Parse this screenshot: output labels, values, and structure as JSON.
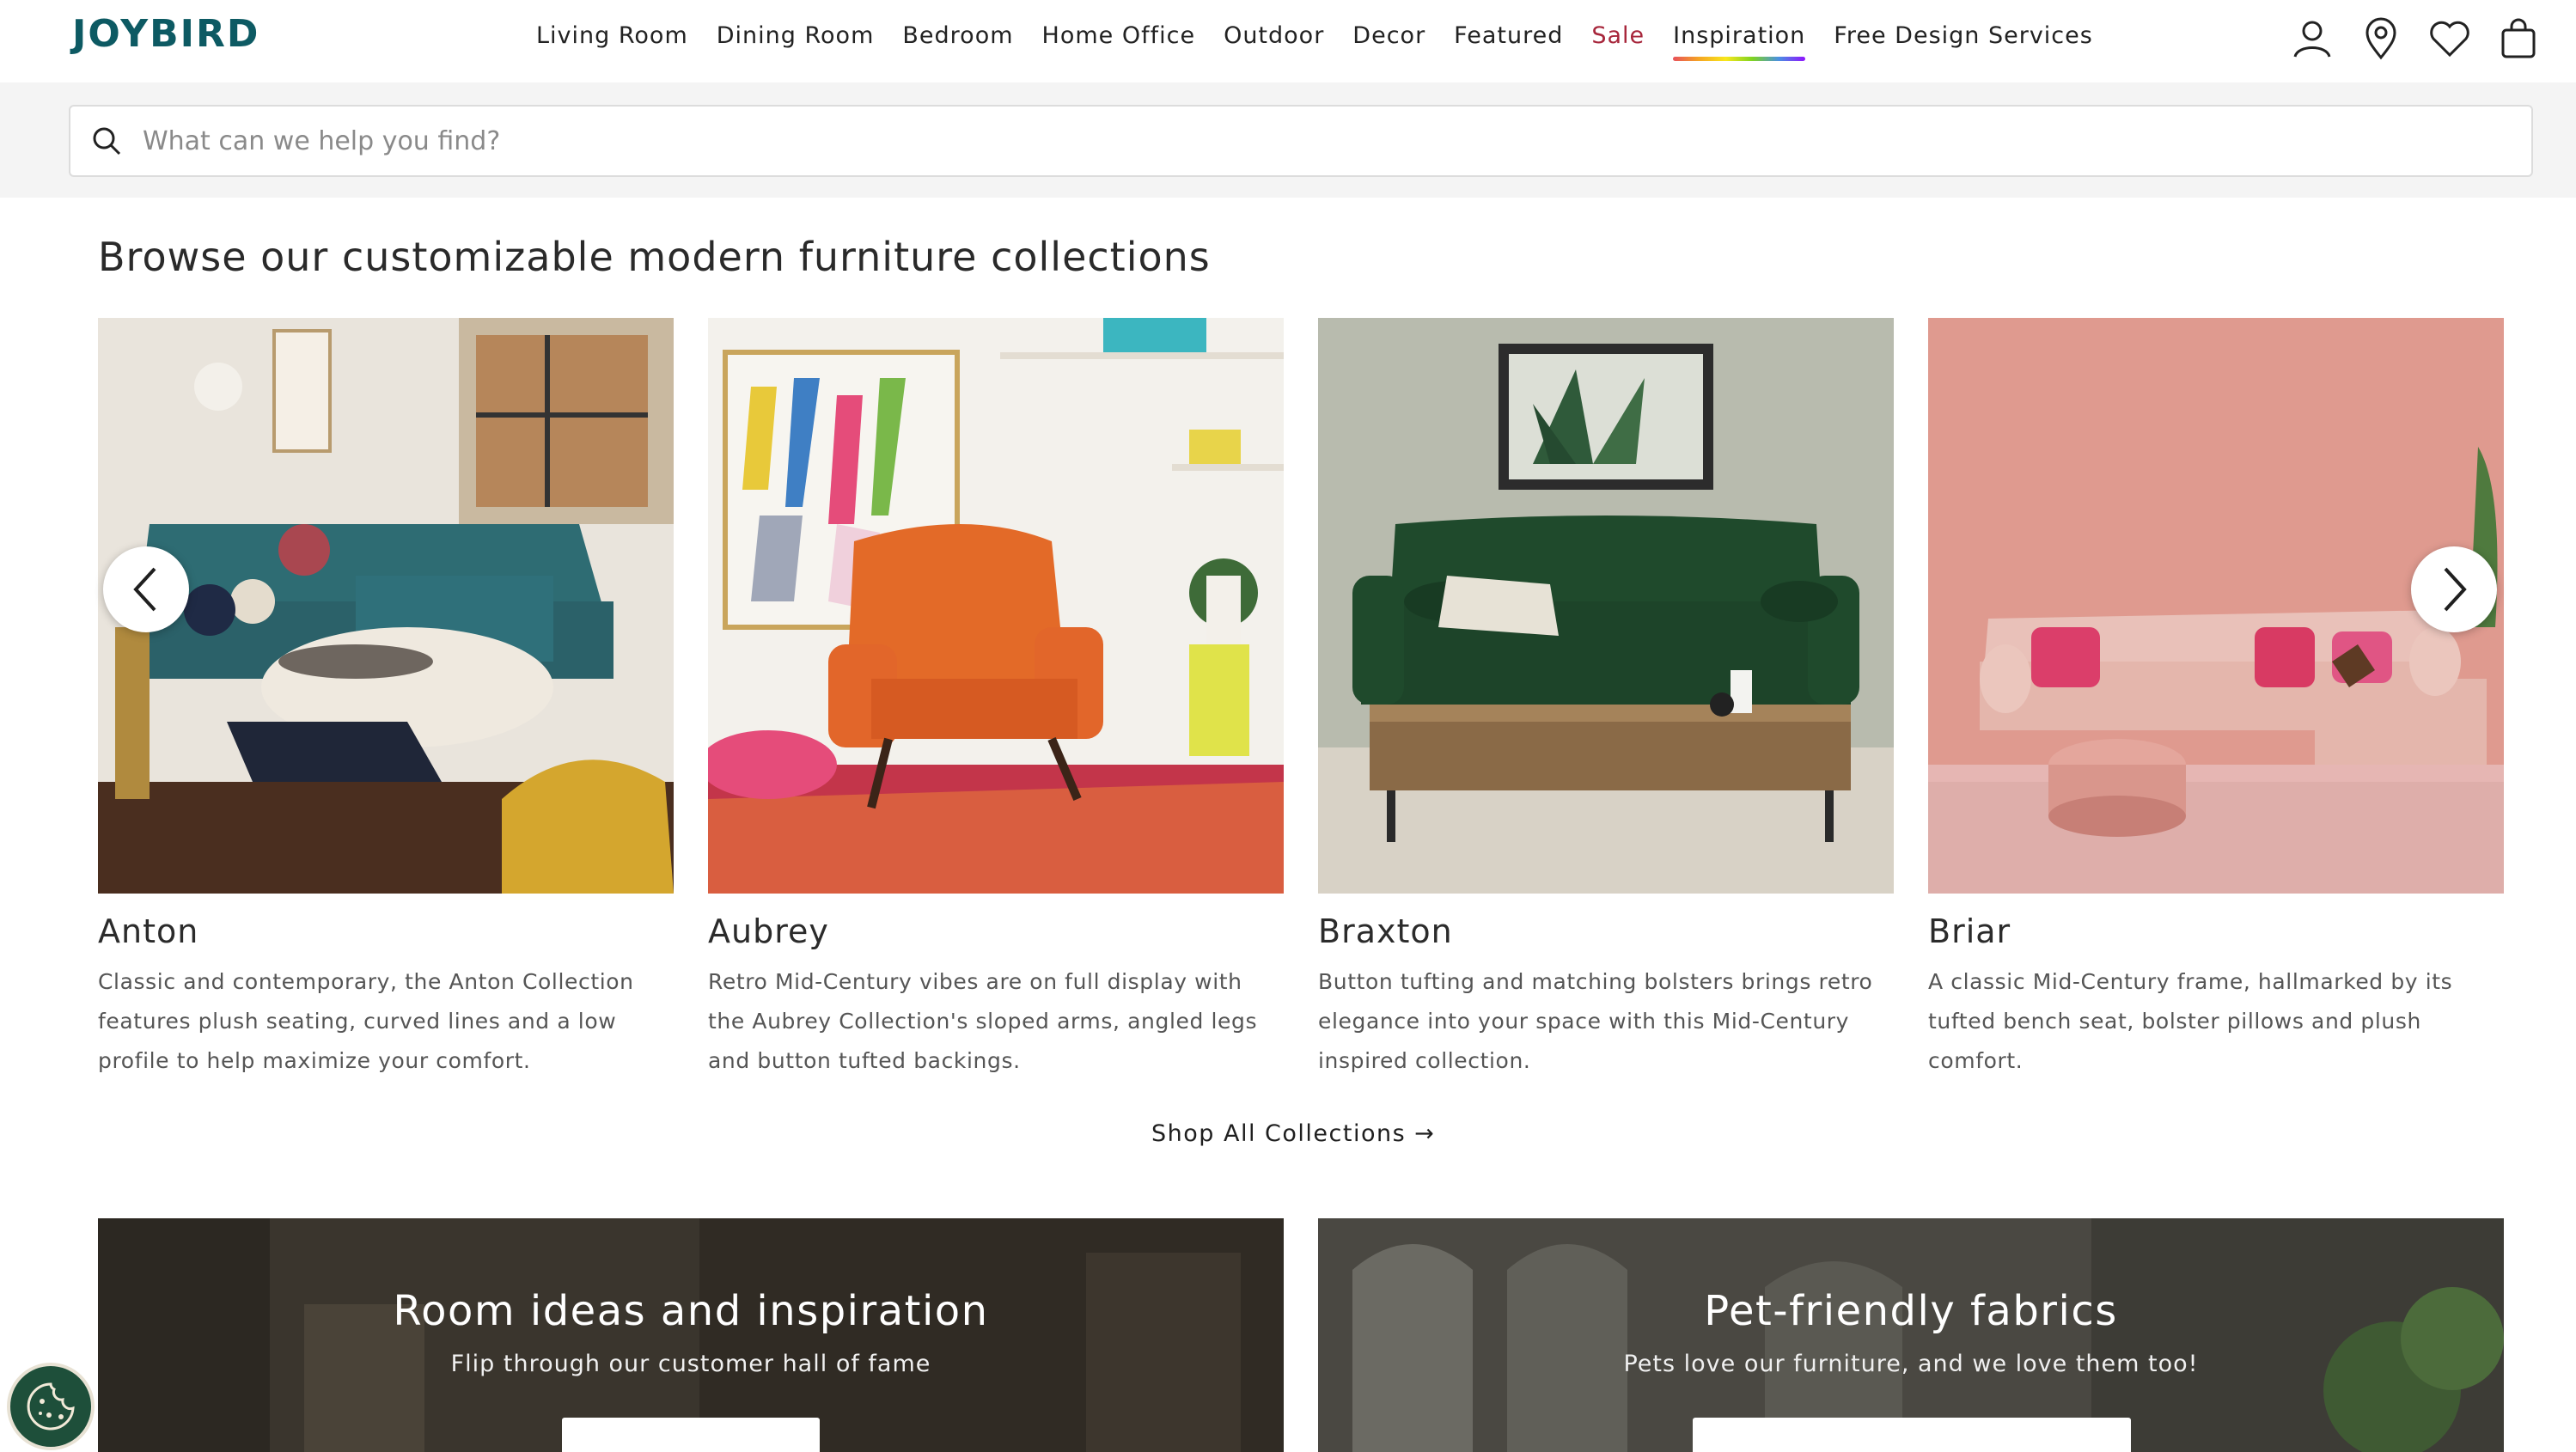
{
  "brand": {
    "logo": "JOYBIRD"
  },
  "nav": {
    "items": [
      {
        "label": "Living Room"
      },
      {
        "label": "Dining Room"
      },
      {
        "label": "Bedroom"
      },
      {
        "label": "Home Office"
      },
      {
        "label": "Outdoor"
      },
      {
        "label": "Decor"
      },
      {
        "label": "Featured"
      },
      {
        "label": "Sale"
      },
      {
        "label": "Inspiration"
      },
      {
        "label": "Free Design Services"
      }
    ]
  },
  "header_icons": [
    "account-icon",
    "location-pin-icon",
    "heart-icon",
    "shopping-bag-icon"
  ],
  "search": {
    "placeholder": "What can we help you find?"
  },
  "section": {
    "title": "Browse our customizable modern furniture collections"
  },
  "collections": [
    {
      "name": "Anton",
      "description": "Classic and contemporary, the Anton Collection features plush seating, curved lines and a low profile to help maximize your comfort."
    },
    {
      "name": "Aubrey",
      "description": "Retro Mid-Century vibes are on full display with the Aubrey Collection's sloped arms, angled legs and button tufted backings."
    },
    {
      "name": "Braxton",
      "description": "Button tufting and matching bolsters brings retro elegance into your space with this Mid-Century inspired collection."
    },
    {
      "name": "Briar",
      "description": "A classic Mid-Century frame, hallmarked by its tufted bench seat, bolster pillows and plush comfort."
    }
  ],
  "shop_all": {
    "label": "Shop All Collections",
    "arrow": "→"
  },
  "promos": [
    {
      "title": "Room ideas and inspiration",
      "subtitle": "Flip through our customer hall of fame"
    },
    {
      "title": "Pet-friendly fabrics",
      "subtitle": "Pets love our furniture, and we love them too!"
    }
  ],
  "colors": {
    "brand": "#0d5a63",
    "sale": "#a7263b"
  }
}
